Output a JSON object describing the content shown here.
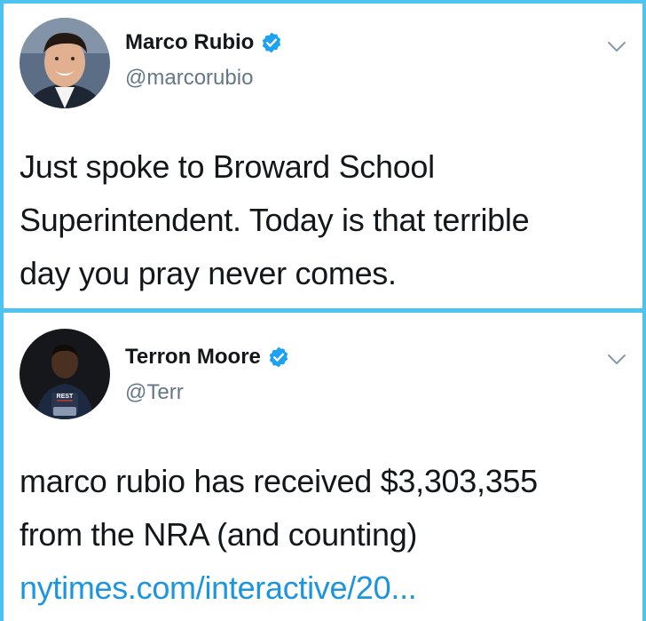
{
  "tweets": [
    {
      "author_name": "Marco Rubio",
      "author_handle": "@marcorubio",
      "verified": true,
      "text_lines": [
        "Just spoke to Broward School",
        "Superintendent. Today is that terrible",
        "day you pray never comes."
      ]
    },
    {
      "author_name": "Terron Moore",
      "author_handle": "@Terr",
      "verified": true,
      "shirt_text": "REST",
      "text_lines": [
        "marco rubio has received $3,303,355",
        "from the NRA (and counting)"
      ],
      "link_text": "nytimes.com/interactive/20..."
    }
  ],
  "colors": {
    "border": "#4fc3ef",
    "verified": "#1da1f2",
    "link": "#1b95e0",
    "handle": "#657786"
  },
  "icons": [
    "verified-badge-icon",
    "chevron-down-icon"
  ]
}
